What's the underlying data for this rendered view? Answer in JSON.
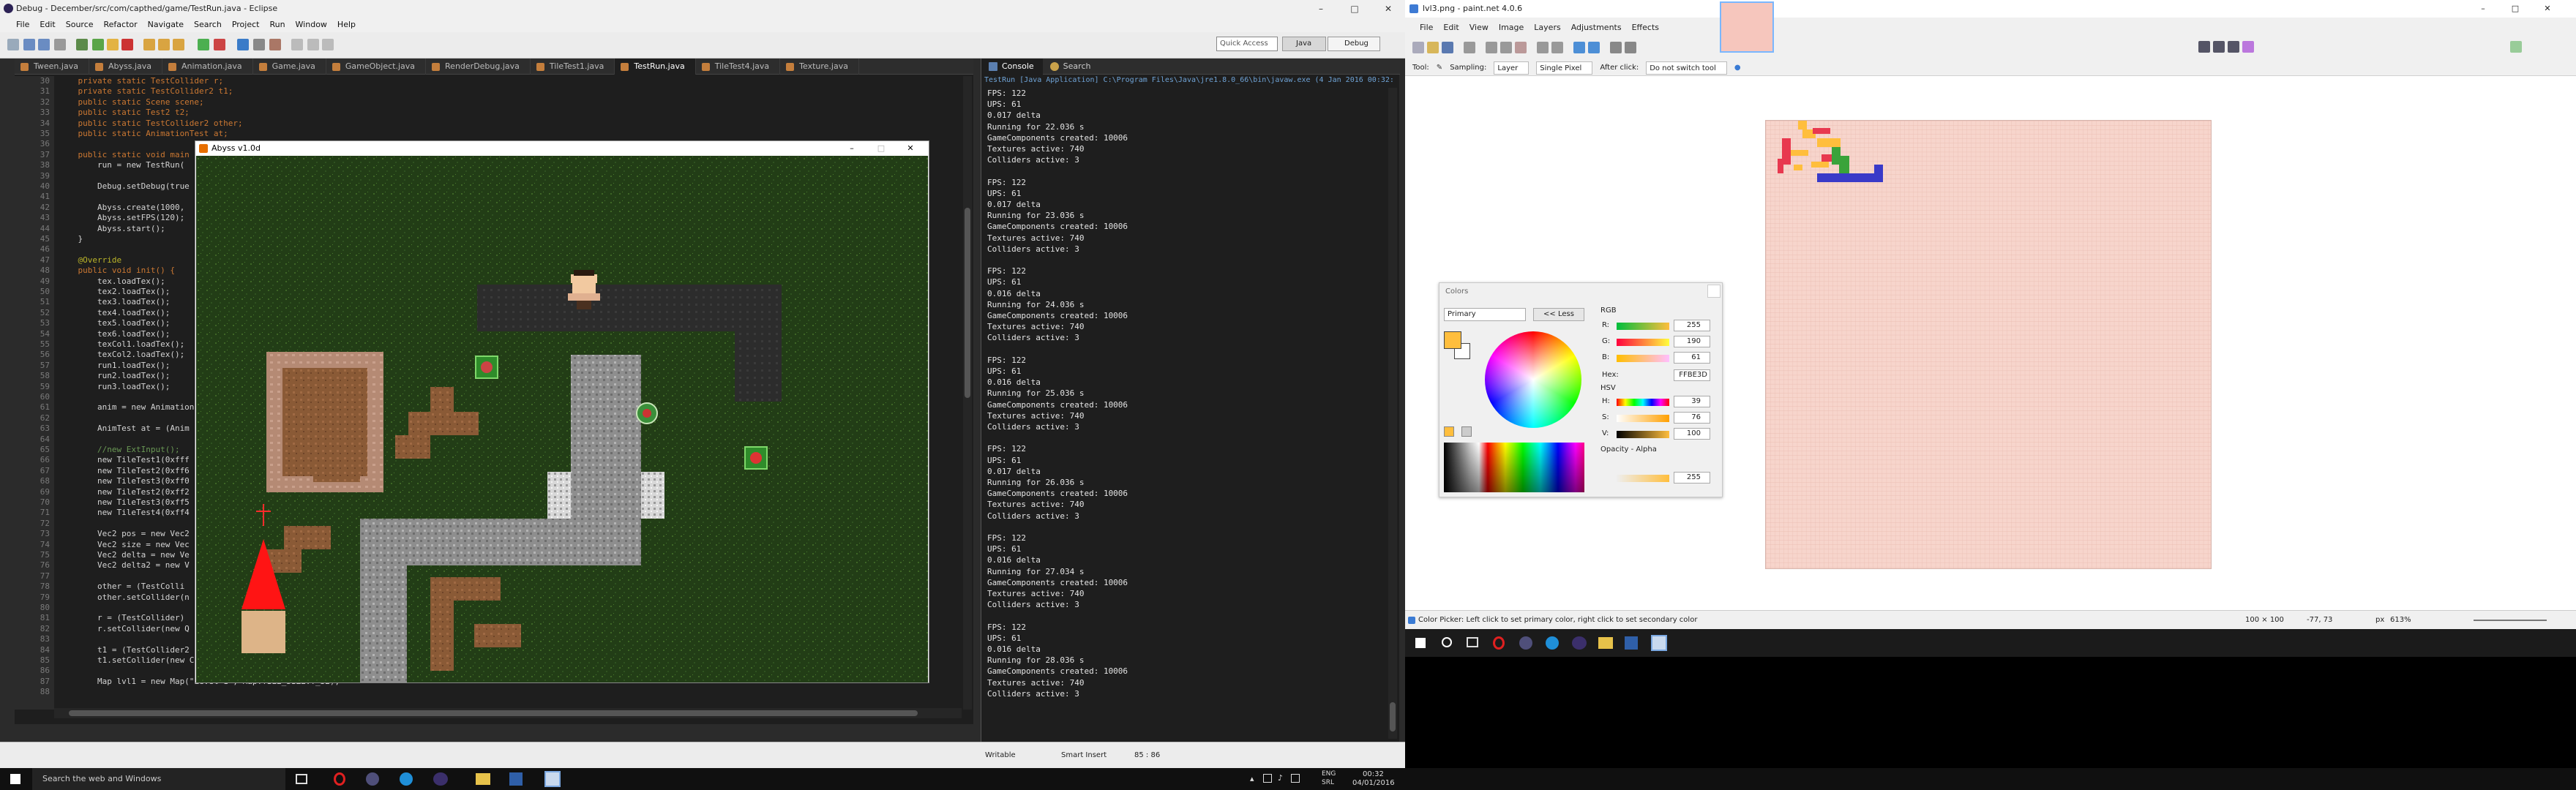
{
  "eclipse": {
    "title": "Debug - December/src/com/capthed/game/TestRun.java - Eclipse",
    "menu": [
      "File",
      "Edit",
      "Source",
      "Refactor",
      "Navigate",
      "Search",
      "Project",
      "Run",
      "Window",
      "Help"
    ],
    "quick_access": "Quick Access",
    "perspectives": {
      "java": "Java",
      "debug": "Debug"
    },
    "tabs": [
      "Tween.java",
      "Abyss.java",
      "Animation.java",
      "Game.java",
      "GameObject.java",
      "RenderDebug.java",
      "TileTest1.java",
      "TestRun.java",
      "TileTest4.java",
      "Texture.java"
    ],
    "active_tab": 7,
    "line_numbers": [
      "30",
      "31",
      "32",
      "33",
      "34",
      "35",
      "36",
      "37",
      "38",
      "39",
      "40",
      "41",
      "42",
      "43",
      "44",
      "45",
      "46",
      "47",
      "48",
      "49",
      "50",
      "51",
      "52",
      "53",
      "54",
      "55",
      "56",
      "57",
      "58",
      "59",
      "60",
      "61",
      "62",
      "63",
      "64",
      "65",
      "66",
      "67",
      "68",
      "69",
      "70",
      "71",
      "72",
      "73",
      "74",
      "75",
      "76",
      "77",
      "78",
      "79",
      "80",
      "81",
      "82",
      "83",
      "84",
      "85",
      "86",
      "87",
      "88"
    ],
    "code_lines": [
      "    private static TestCollider r;",
      "    private static TestCollider2 t1;",
      "    public static Scene scene;",
      "    public static Test2 t2;",
      "    public static TestCollider2 other;",
      "    public static AnimationTest at;",
      "",
      "    public static void main",
      "        run = new TestRun(",
      "",
      "        Debug.setDebug(true",
      "",
      "        Abyss.create(1000,",
      "        Abyss.setFPS(120);",
      "        Abyss.start();",
      "    }",
      "",
      "    @Override",
      "    public void init() {",
      "        tex.loadTex();",
      "        tex2.loadTex();",
      "        tex3.loadTex();",
      "        tex4.loadTex();",
      "        tex5.loadTex();",
      "        tex6.loadTex();",
      "        texCol1.loadTex();",
      "        texCol2.loadTex();",
      "        run1.loadTex();",
      "        run2.loadTex();",
      "        run3.loadTex();",
      "",
      "        anim = new Animation",
      "",
      "        AnimTest at = (Anim",
      "",
      "        //new ExtInput();",
      "        new TileTest1(0xfff",
      "        new TileTest2(0xff6",
      "        new TileTest3(0xff0",
      "        new TileTest2(0xff2",
      "        new TileTest3(0xff5",
      "        new TileTest4(0xff4",
      "",
      "        Vec2 pos = new Vec2",
      "        Vec2 size = new Vec",
      "        Vec2 delta = new Ve",
      "        Vec2 delta2 = new V",
      "",
      "        other = (TestColli",
      "        other.setCollider(n",
      "",
      "        r = (TestCollider)",
      "        r.setCollider(new Q",
      "",
      "        t1 = (TestCollider2",
      "        t1.setCollider(new CircleCollider(t1.getCollider().calcCenter(t1), size.x() / 2)); // ONE 5 PROBLEM",
      "",
      "        Map lvl1 = new Map(\"Level 1\", Map.TILE_SIZE.T_32);",
      ""
    ],
    "status": {
      "writable": "Writable",
      "insert": "Smart Insert",
      "position": "85 : 86"
    }
  },
  "game_window": {
    "title": "Abyss v1.0d"
  },
  "console": {
    "tabs": [
      "Console",
      "Search"
    ],
    "path": "TestRun [Java Application] C:\\Program Files\\Java\\jre1.8.0_66\\bin\\javaw.exe (4 Jan 2016 00:32:10)",
    "lines": [
      "FPS: 122",
      "UPS: 61",
      "0.017 delta",
      "Running for 22.036 s",
      "GameComponents created: 10006",
      "Textures active: 740",
      "Colliders active: 3",
      "",
      "FPS: 122",
      "UPS: 61",
      "0.017 delta",
      "Running for 23.036 s",
      "GameComponents created: 10006",
      "Textures active: 740",
      "Colliders active: 3",
      "",
      "FPS: 122",
      "UPS: 61",
      "0.016 delta",
      "Running for 24.036 s",
      "GameComponents created: 10006",
      "Textures active: 740",
      "Colliders active: 3",
      "",
      "FPS: 122",
      "UPS: 61",
      "0.016 delta",
      "Running for 25.036 s",
      "GameComponents created: 10006",
      "Textures active: 740",
      "Colliders active: 3",
      "",
      "FPS: 122",
      "UPS: 61",
      "0.017 delta",
      "Running for 26.036 s",
      "GameComponents created: 10006",
      "Textures active: 740",
      "Colliders active: 3",
      "",
      "FPS: 122",
      "UPS: 61",
      "0.016 delta",
      "Running for 27.034 s",
      "GameComponents created: 10006",
      "Textures active: 740",
      "Colliders active: 3",
      "",
      "FPS: 122",
      "UPS: 61",
      "0.016 delta",
      "Running for 28.036 s",
      "GameComponents created: 10006",
      "Textures active: 740",
      "Colliders active: 3"
    ]
  },
  "paint": {
    "title": "lvl3.png - paint.net 4.0.6",
    "menu": [
      "File",
      "Edit",
      "View",
      "Image",
      "Layers",
      "Adjustments",
      "Effects"
    ],
    "options": {
      "tool": "Tool:",
      "sampling_label": "Sampling:",
      "sampling_value": "Layer",
      "sample_mode": "Single Pixel",
      "after_label": "After click:",
      "after_value": "Do not switch tool"
    },
    "status_hint": "Color Picker: Left click to set primary color, right click to set secondary color",
    "status_size": "100 × 100",
    "status_coords": "-77, 73",
    "status_unit": "px",
    "status_zoom": "613%"
  },
  "colors_panel": {
    "title": "Colors",
    "mode": "Primary",
    "less_button": "<< Less",
    "rgb_label": "RGB",
    "hsv_label": "HSV",
    "r_label": "R:",
    "r": "255",
    "g_label": "G:",
    "g": "190",
    "b_label": "B:",
    "b": "61",
    "hex_label": "Hex:",
    "hex": "FFBE3D",
    "h_label": "H:",
    "h": "39",
    "s_label": "S:",
    "s": "76",
    "v_label": "V:",
    "v": "100",
    "opacity_label": "Opacity - Alpha",
    "opacity": "255",
    "primary_color": "#ffbe3d",
    "secondary_color": "#ffffff"
  },
  "taskbar": {
    "search": "Search the web and Windows",
    "lang": "ENG",
    "region": "SRL",
    "time": "00:32",
    "date": "04/01/2016"
  }
}
